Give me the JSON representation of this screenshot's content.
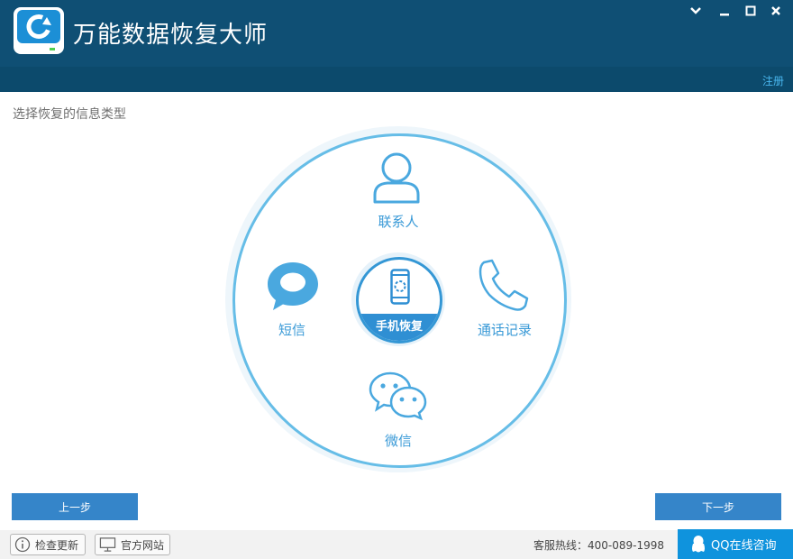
{
  "app": {
    "title": "万能数据恢复大师",
    "logo_icon": "refresh-drive-icon",
    "window_controls": [
      "chevron-down-icon",
      "minimize-icon",
      "maximize-icon",
      "close-icon"
    ],
    "register_label": "注册"
  },
  "main": {
    "section_title": "选择恢复的信息类型",
    "center": {
      "label": "手机恢复",
      "icon": "phone-icon"
    },
    "options": [
      {
        "label": "联系人",
        "icon": "person-icon"
      },
      {
        "label": "短信",
        "icon": "message-bubble-icon"
      },
      {
        "label": "通话记录",
        "icon": "telephone-icon"
      },
      {
        "label": "微信",
        "icon": "wechat-icon"
      }
    ]
  },
  "nav": {
    "prev_label": "上一步",
    "next_label": "下一步"
  },
  "footer": {
    "check_update_label": "检查更新",
    "website_label": "官方网站",
    "hotline": "客服热线：400-089-1998",
    "qq_label": "QQ在线咨询"
  },
  "colors": {
    "titlebar": "#0f4f74",
    "accent": "#3a9ad7",
    "button": "#3585c9",
    "qq_button": "#0f93dd"
  }
}
